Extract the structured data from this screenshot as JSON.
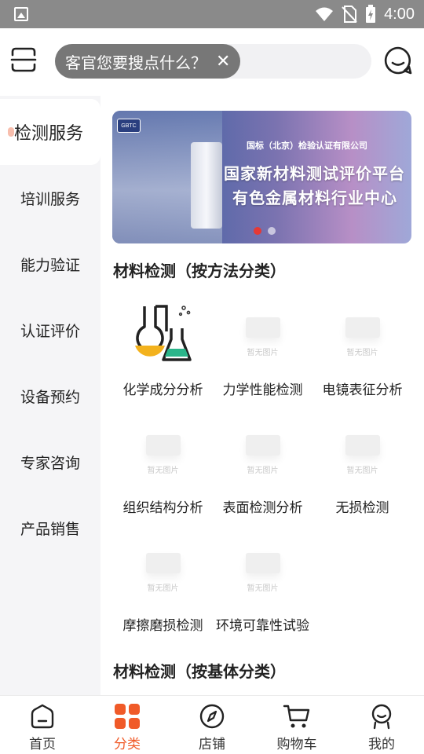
{
  "status_bar": {
    "time": "4:00"
  },
  "search": {
    "placeholder": "客官您要搜点什么？"
  },
  "sidebar": {
    "items": [
      {
        "label": "检测服务",
        "active": true
      },
      {
        "label": "培训服务"
      },
      {
        "label": "能力验证"
      },
      {
        "label": "认证评价"
      },
      {
        "label": "设备预约"
      },
      {
        "label": "专家咨询"
      },
      {
        "label": "产品销售"
      }
    ]
  },
  "banner": {
    "logo_text": "GBTC",
    "company": "国标（北京）检验认证有限公司",
    "line1": "国家新材料测试评价平台",
    "line2": "有色金属材料行业中心"
  },
  "sections": [
    {
      "title": "材料检测（按方法分类）",
      "items": [
        {
          "label": "化学成分分析",
          "icon": "chemistry-flask-icon"
        },
        {
          "label": "力学性能检测",
          "placeholder": "暂无图片"
        },
        {
          "label": "电镜表征分析",
          "placeholder": "暂无图片"
        },
        {
          "label": "组织结构分析",
          "placeholder": "暂无图片"
        },
        {
          "label": "表面检测分析",
          "placeholder": "暂无图片"
        },
        {
          "label": "无损检测",
          "placeholder": "暂无图片"
        },
        {
          "label": "摩擦磨损检测",
          "placeholder": "暂无图片"
        },
        {
          "label": "环境可靠性试验",
          "placeholder": "暂无图片"
        }
      ]
    },
    {
      "title": "材料检测（按基体分类）"
    }
  ],
  "tabbar": {
    "items": [
      {
        "label": "首页",
        "icon": "home-icon"
      },
      {
        "label": "分类",
        "icon": "category-grid-icon",
        "active": true
      },
      {
        "label": "店铺",
        "icon": "compass-icon"
      },
      {
        "label": "购物车",
        "icon": "cart-icon"
      },
      {
        "label": "我的",
        "icon": "profile-icon"
      }
    ]
  },
  "colors": {
    "accent": "#f05a28",
    "sidebar_bg": "#f5f5f7",
    "status_bar": "#8a8a8a"
  }
}
